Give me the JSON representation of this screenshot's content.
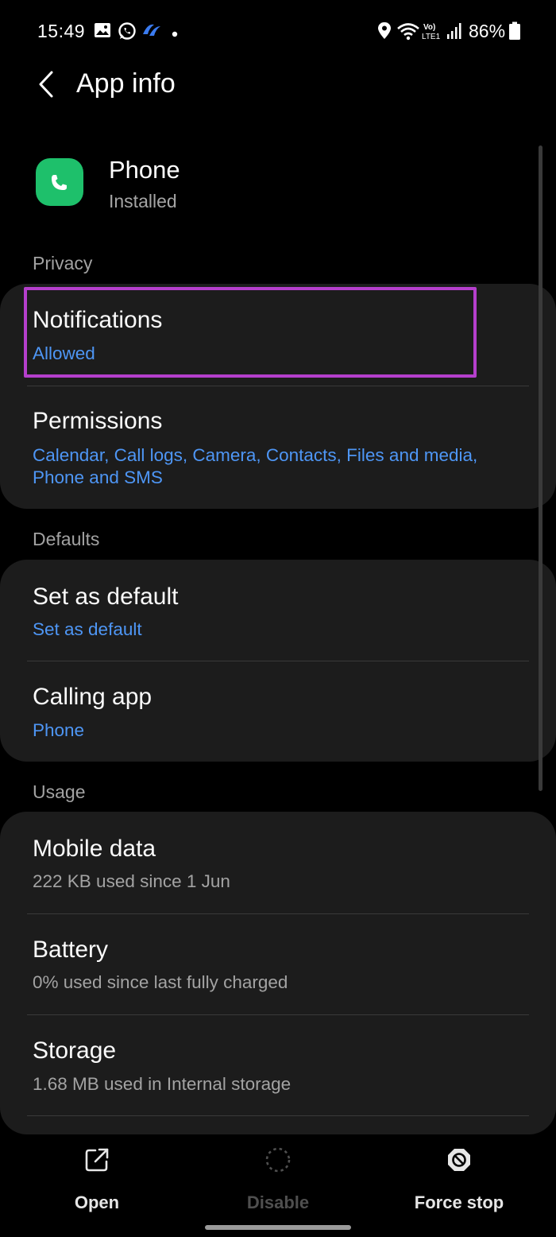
{
  "status_bar": {
    "time": "15:49",
    "battery_percent": "86%",
    "network_label": "Vo) LTE1",
    "icons": [
      "gallery-icon",
      "whatsapp-icon",
      "app-notification-icon",
      "dot-icon",
      "location-icon",
      "wifi-icon",
      "volte-icon",
      "signal-icon",
      "battery-icon"
    ]
  },
  "header": {
    "title": "App info",
    "back_icon": "back-arrow-icon"
  },
  "app": {
    "name": "Phone",
    "status": "Installed",
    "icon": "phone-app-icon",
    "icon_color": "#1ec06b"
  },
  "sections": {
    "privacy": "Privacy",
    "defaults": "Defaults",
    "usage": "Usage"
  },
  "privacy_items": [
    {
      "title": "Notifications",
      "subtitle": "Allowed"
    },
    {
      "title": "Permissions",
      "subtitle_line1": "Calendar, Call logs, Camera, Contacts, Files and media,",
      "subtitle_line2": "Phone and SMS"
    }
  ],
  "defaults_items": [
    {
      "title": "Set as default",
      "subtitle": "Set as default"
    },
    {
      "title": "Calling app",
      "subtitle": "Phone"
    }
  ],
  "usage_items": [
    {
      "title": "Mobile data",
      "subtitle": "222 KB used since 1 Jun"
    },
    {
      "title": "Battery",
      "subtitle": "0% used since last fully charged"
    },
    {
      "title": "Storage",
      "subtitle": "1.68 MB used in Internal storage"
    }
  ],
  "bottom_bar": {
    "open": "Open",
    "disable": "Disable",
    "force_stop": "Force stop"
  },
  "colors": {
    "accent_blue": "#4e96f5",
    "highlight_border": "#b53fcc",
    "card_bg": "#1c1c1c"
  }
}
